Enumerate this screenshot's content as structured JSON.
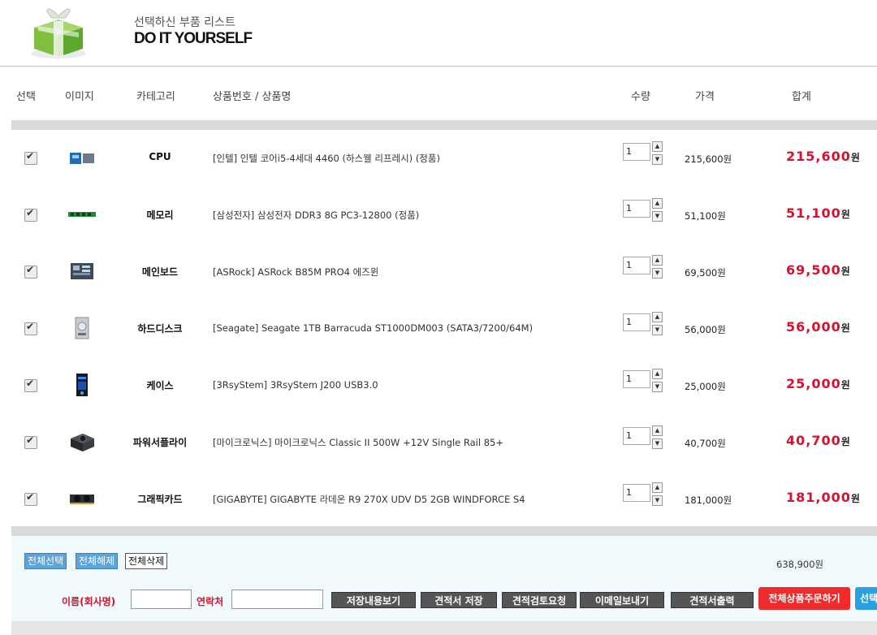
{
  "header": {
    "subtitle": "선택하신 부품 리스트",
    "title": "DO IT YOURSELF"
  },
  "columns": {
    "select": "선택",
    "image": "이미지",
    "category": "카테고리",
    "product": "상품번호 / 상품명",
    "qty": "수량",
    "price": "가격",
    "total": "합계"
  },
  "items": [
    {
      "category": "CPU",
      "name": "[인텔] 인텔 코어i5-4세대 4460 (하스웰 리프레시) (정품)",
      "qty": "1",
      "price": "215,600원",
      "total": "215,600",
      "unit": "원",
      "checked": true,
      "thumb": "cpu-box-thumbnail"
    },
    {
      "category": "메모리",
      "name": "[삼성전자] 삼성전자 DDR3 8G PC3-12800 (정품)",
      "qty": "1",
      "price": "51,100원",
      "total": "51,100",
      "unit": "원",
      "checked": true,
      "thumb": "ram-stick-thumbnail"
    },
    {
      "category": "메인보드",
      "name": "[ASRock] ASRock B85M PRO4 에즈윈",
      "qty": "1",
      "price": "69,500원",
      "total": "69,500",
      "unit": "원",
      "checked": true,
      "thumb": "motherboard-thumbnail"
    },
    {
      "category": "하드디스크",
      "name": "[Seagate] Seagate 1TB Barracuda ST1000DM003 (SATA3/7200/64M)",
      "qty": "1",
      "price": "56,000원",
      "total": "56,000",
      "unit": "원",
      "checked": true,
      "thumb": "hdd-thumbnail"
    },
    {
      "category": "케이스",
      "name": "[3RsyStem] 3RsyStem J200 USB3.0",
      "qty": "1",
      "price": "25,000원",
      "total": "25,000",
      "unit": "원",
      "checked": true,
      "thumb": "case-thumbnail"
    },
    {
      "category": "파워서플라이",
      "name": "[마이크로닉스] 마이크로닉스 Classic II 500W +12V Single Rail 85+",
      "qty": "1",
      "price": "40,700원",
      "total": "40,700",
      "unit": "원",
      "checked": true,
      "thumb": "psu-thumbnail"
    },
    {
      "category": "그래픽카드",
      "name": "[GIGABYTE] GIGABYTE 라데온 R9 270X UDV D5 2GB WINDFORCE S4",
      "qty": "1",
      "price": "181,000원",
      "total": "181,000",
      "unit": "원",
      "checked": true,
      "thumb": "gpu-thumbnail"
    }
  ],
  "footer": {
    "select_all": "전체선택",
    "deselect_all": "전체해제",
    "delete_all": "전체삭제",
    "sum": "638,900원",
    "name_label": "이름(회사명)",
    "contact_label": "연락처",
    "buttons": {
      "view_saved": "저장내용보기",
      "save_quote": "견적서 저장",
      "request_review": "견적검토요청",
      "send_email": "이메일보내기",
      "print_quote": "견적서출력",
      "order_all": "전체상품주문하기",
      "order_selected": "선택"
    }
  },
  "colors": {
    "accent_red": "#d9102e",
    "header_line": "#9ecfe6",
    "order_red": "#ef2b2b",
    "order_blue": "#2aa0e0"
  }
}
